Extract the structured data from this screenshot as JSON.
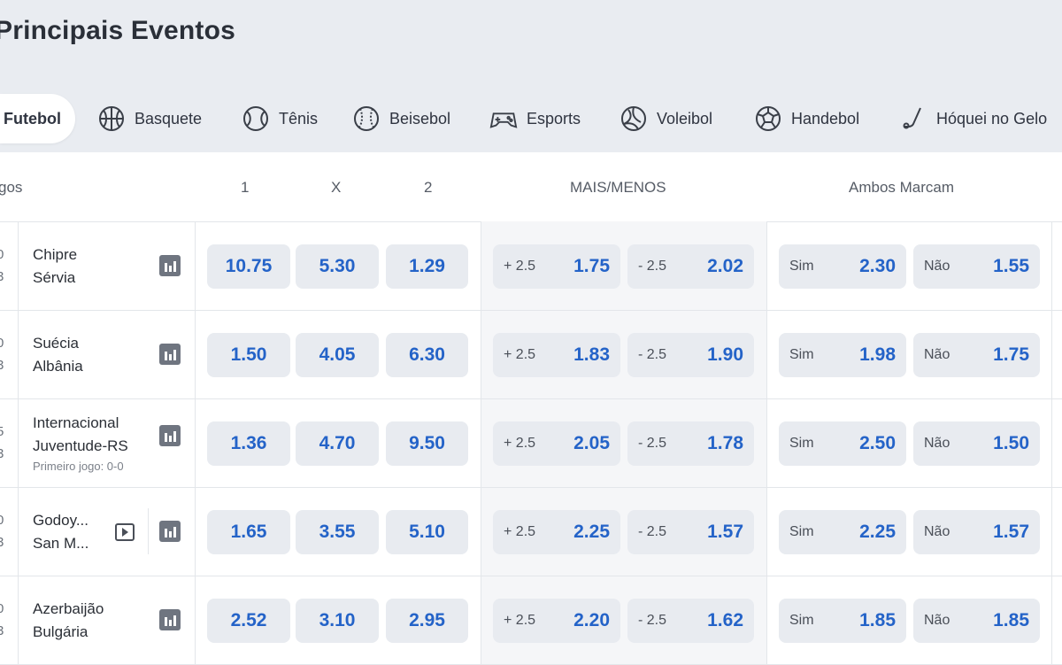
{
  "page_title": "Principais Eventos",
  "tabs": [
    {
      "label": "Futebol",
      "icon": "soccer-ball-icon",
      "active": true
    },
    {
      "label": "Basquete",
      "icon": "basketball-icon"
    },
    {
      "label": "Tênis",
      "icon": "tennis-ball-icon"
    },
    {
      "label": "Beisebol",
      "icon": "baseball-icon"
    },
    {
      "label": "Esports",
      "icon": "gamepad-icon"
    },
    {
      "label": "Voleibol",
      "icon": "volleyball-icon"
    },
    {
      "label": "Handebol",
      "icon": "handball-icon"
    },
    {
      "label": "Hóquei no Gelo",
      "icon": "hockey-stick-icon"
    }
  ],
  "table_header": {
    "games": "gos",
    "col1": "1",
    "colx": "X",
    "col2": "2",
    "over_under": "MAIS/MENOS",
    "btts": "Ambos Marcam"
  },
  "accent_color": "#2463c8",
  "matches": [
    {
      "time_top": "0",
      "time_bottom": "3",
      "home": "Chipre",
      "away": "Sérvia",
      "note": "",
      "odds_1": "10.75",
      "odds_x": "5.30",
      "odds_2": "1.29",
      "over_label": "+ 2.5",
      "over_odds": "1.75",
      "under_label": "- 2.5",
      "under_odds": "2.02",
      "yes_label": "Sim",
      "yes_odds": "2.30",
      "no_label": "Não",
      "no_odds": "1.55"
    },
    {
      "time_top": "0",
      "time_bottom": "3",
      "home": "Suécia",
      "away": "Albânia",
      "note": "",
      "odds_1": "1.50",
      "odds_x": "4.05",
      "odds_2": "6.30",
      "over_label": "+ 2.5",
      "over_odds": "1.83",
      "under_label": "- 2.5",
      "under_odds": "1.90",
      "yes_label": "Sim",
      "yes_odds": "1.98",
      "no_label": "Não",
      "no_odds": "1.75"
    },
    {
      "time_top": "5",
      "time_bottom": "3",
      "home": "Internacional",
      "away": "Juventude-RS",
      "note": "Primeiro jogo: 0-0",
      "odds_1": "1.36",
      "odds_x": "4.70",
      "odds_2": "9.50",
      "over_label": "+ 2.5",
      "over_odds": "2.05",
      "under_label": "- 2.5",
      "under_odds": "1.78",
      "yes_label": "Sim",
      "yes_odds": "2.50",
      "no_label": "Não",
      "no_odds": "1.50"
    },
    {
      "time_top": "0",
      "time_bottom": "3",
      "home": "Godoy...",
      "away": "San M...",
      "note": "",
      "live_stream": true,
      "odds_1": "1.65",
      "odds_x": "3.55",
      "odds_2": "5.10",
      "over_label": "+ 2.5",
      "over_odds": "2.25",
      "under_label": "- 2.5",
      "under_odds": "1.57",
      "yes_label": "Sim",
      "yes_odds": "2.25",
      "no_label": "Não",
      "no_odds": "1.57"
    },
    {
      "time_top": "0",
      "time_bottom": "3",
      "home": "Azerbaijão",
      "away": "Bulgária",
      "note": "",
      "odds_1": "2.52",
      "odds_x": "3.10",
      "odds_2": "2.95",
      "over_label": "+ 2.5",
      "over_odds": "2.20",
      "under_label": "- 2.5",
      "under_odds": "1.62",
      "yes_label": "Sim",
      "yes_odds": "1.85",
      "no_label": "Não",
      "no_odds": "1.85"
    }
  ]
}
